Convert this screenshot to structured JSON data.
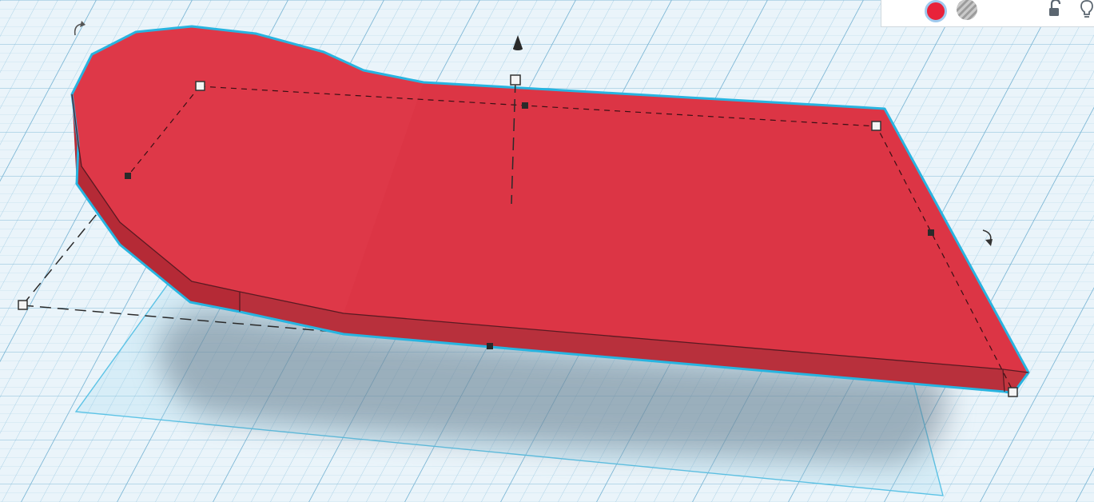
{
  "viewport": {
    "name": "tinkercad-3d-workplane",
    "grid_color": "#8fc3dd",
    "background_color": "#e9f3f9"
  },
  "shape": {
    "kind": "extruded-flat-shape",
    "top_color": "#dc3545",
    "side_color": "#b52a36",
    "selection_outline_color": "#28b4e0",
    "selected": true
  },
  "toolbar": {
    "solid_color": "#e8223a",
    "solid_swatch": "solid-color-swatch",
    "hole_swatch": "hole-pattern-swatch",
    "icons": [
      "lock-open-icon",
      "light-bulb-icon"
    ]
  },
  "handles": {
    "rotation": [
      "rotate-arrow-icon",
      "rotate-arrow-icon"
    ],
    "height": "cone-height-handle-icon"
  }
}
